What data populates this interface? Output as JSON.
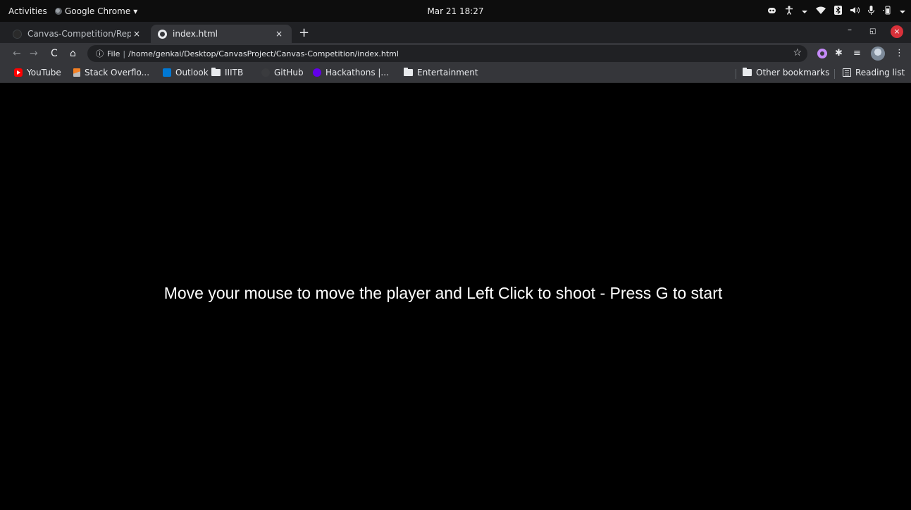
{
  "topbar": {
    "activities": "Activities",
    "app_name": "Google Chrome",
    "app_menu_icon": "▾",
    "clock": "Mar 21  18:27",
    "tray_icons": [
      "discord-icon",
      "accessibility-icon",
      "wifi-icon",
      "bluetooth-icon",
      "volume-icon",
      "microphone-icon",
      "battery-icon",
      "power-menu-icon"
    ]
  },
  "tabs": [
    {
      "title": "Canvas-Competition/Repo",
      "close": "×",
      "active": false
    },
    {
      "title": "index.html",
      "close": "×",
      "active": true
    }
  ],
  "new_tab": "+",
  "window_controls": {
    "minimize": "–",
    "maximize": "◱",
    "close": "×"
  },
  "toolbar": {
    "back": "←",
    "forward": "→",
    "reload": "C",
    "home": "⌂",
    "url_info": "ⓘ",
    "url_scheme": "File",
    "url_separator": "|",
    "url": "/home/genkai/Desktop/CanvasProject/Canvas-Competition/index.html",
    "star": "☆",
    "puzzle": "✱",
    "media": "≡",
    "menu": "⋮"
  },
  "bookmarks": [
    {
      "label": "YouTube"
    },
    {
      "label": "Stack Overflo..."
    },
    {
      "label": "Outlook"
    },
    {
      "label": "IIITB"
    },
    {
      "label": "GitHub"
    },
    {
      "label": "Hackathons |..."
    },
    {
      "label": "Entertainment"
    }
  ],
  "bookmarks_right": {
    "other": "Other bookmarks",
    "reading_list": "Reading list"
  },
  "game": {
    "instructions": "Move your mouse to move the player and Left Click to shoot - Press G to start",
    "background": "#000000",
    "text_color": "#ffffff"
  }
}
